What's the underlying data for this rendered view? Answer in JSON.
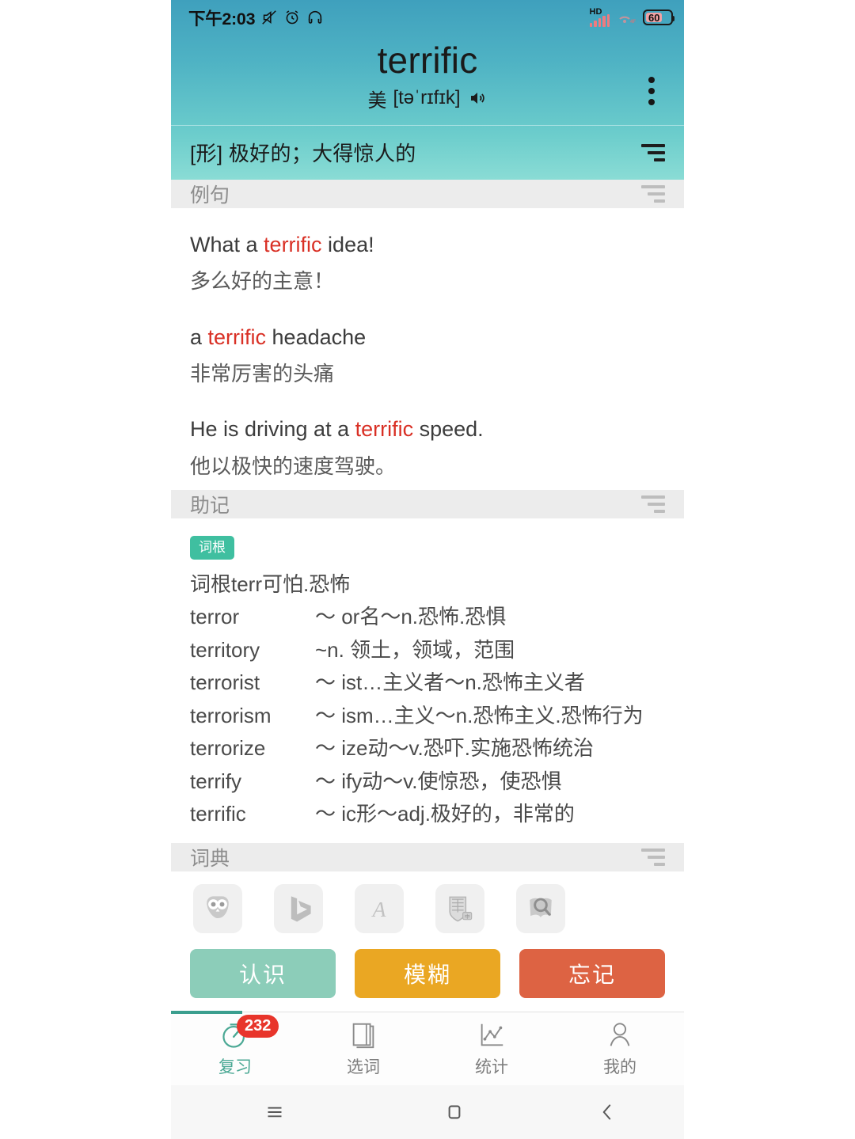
{
  "statusbar": {
    "time": "下午2:03",
    "icons": [
      "mute-icon",
      "alarm-icon",
      "headphones-icon"
    ],
    "hd_label": "HD",
    "signal_icon": "signal-bars-icon",
    "data_icon": "mobile-data-icon",
    "battery_percent": "60"
  },
  "header": {
    "word": "terrific",
    "accent_label": "美",
    "phonetic": "[təˈrɪfɪk]",
    "speaker_icon": "speaker-icon",
    "menu_icon": "kebab-menu-icon",
    "definition": "[形] 极好的；大得惊人的",
    "sort_icon": "sort-lines-icon",
    "gradient_top": "#3fa0bd",
    "gradient_bottom": "#8adcd5"
  },
  "sections": {
    "examples": {
      "title": "例句",
      "sort_icon": "sort-lines-icon",
      "items": [
        {
          "en_before": "What a ",
          "en_highlight": "terrific",
          "en_after": " idea!",
          "zh": "多么好的主意！"
        },
        {
          "en_before": "a ",
          "en_highlight": "terrific",
          "en_after": " headache",
          "zh": "非常厉害的头痛"
        },
        {
          "en_before": "He is driving at a ",
          "en_highlight": "terrific",
          "en_after": " speed.",
          "zh": "他以极快的速度驾驶。"
        }
      ],
      "highlight_color": "#d93025"
    },
    "mnemonic": {
      "title": "助记",
      "sort_icon": "sort-lines-icon",
      "tag": "词根",
      "tag_color": "#3fbfa0",
      "intro": "词根terr可怕.恐怖",
      "entries": [
        {
          "word": "terror",
          "desc": "～ or名～n.恐怖.恐惧"
        },
        {
          "word": "territory",
          "desc": "~n. 领土，领域，范围"
        },
        {
          "word": "terrorist",
          "desc": "～ ist…主义者～n.恐怖主义者"
        },
        {
          "word": "terrorism",
          "desc": "～ ism…主义～n.恐怖主义.恐怖行为"
        },
        {
          "word": "terrorize",
          "desc": "～ ize动～v.恐吓.实施恐怖统治"
        },
        {
          "word": "terrify",
          "desc": "～ ify动～v.使惊恐，使恐惧"
        },
        {
          "word": "terrific",
          "desc": "～ ic形～adj.极好的，非常的"
        }
      ]
    },
    "dictionary": {
      "title": "词典",
      "sort_icon": "sort-lines-icon",
      "icons": [
        "owl-dictionary-icon",
        "bing-dictionary-icon",
        "script-a-dictionary-icon",
        "cambridge-crest-dictionary-icon",
        "magnifier-book-dictionary-icon"
      ]
    }
  },
  "actions": {
    "know": {
      "label": "认识",
      "color": "#8ccdb9"
    },
    "vague": {
      "label": "模糊",
      "color": "#eaa723"
    },
    "forget": {
      "label": "忘记",
      "color": "#dd6343"
    }
  },
  "bottom_nav": {
    "active_color": "#4aa894",
    "items": [
      {
        "label": "复习",
        "icon": "timer-icon",
        "badge": "232",
        "active": true
      },
      {
        "label": "选词",
        "icon": "book-icon",
        "badge": "",
        "active": false
      },
      {
        "label": "统计",
        "icon": "line-chart-icon",
        "badge": "",
        "active": false
      },
      {
        "label": "我的",
        "icon": "person-icon",
        "badge": "",
        "active": false
      }
    ],
    "badge_color": "#e8352b"
  },
  "android_nav": {
    "recents_icon": "menu-lines-icon",
    "home_icon": "square-home-icon",
    "back_icon": "chevron-left-icon"
  }
}
